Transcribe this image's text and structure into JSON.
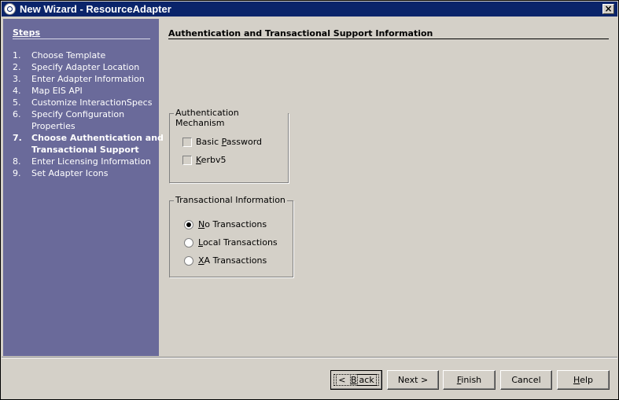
{
  "window": {
    "title": "New Wizard - ResourceAdapter",
    "close_label": "×"
  },
  "sidebar": {
    "heading": "Steps",
    "steps": [
      {
        "num": "1.",
        "label": "Choose Template"
      },
      {
        "num": "2.",
        "label": "Specify Adapter Location"
      },
      {
        "num": "3.",
        "label": "Enter Adapter Information"
      },
      {
        "num": "4.",
        "label": "Map EIS API"
      },
      {
        "num": "5.",
        "label": "Customize InteractionSpecs"
      },
      {
        "num": "6.",
        "label_line1": "Specify Configuration",
        "label_line2": "Properties"
      },
      {
        "num": "7.",
        "label_line1": "Choose Authentication and",
        "label_line2": "Transactional Support"
      },
      {
        "num": "8.",
        "label": "Enter Licensing Information"
      },
      {
        "num": "9.",
        "label": "Set Adapter Icons"
      }
    ],
    "active_step": 7
  },
  "main": {
    "title": "Authentication and Transactional Support Information",
    "auth": {
      "legend": "Authentication Mechanism",
      "options": [
        {
          "label_pre": "Basic ",
          "mnemonic": "P",
          "label_post": "assword",
          "checked": false
        },
        {
          "label_pre": "",
          "mnemonic": "K",
          "label_post": "erbv5",
          "checked": false
        }
      ]
    },
    "transactions": {
      "legend": "Transactional Information",
      "options": [
        {
          "label_pre": "",
          "mnemonic": "N",
          "label_post": "o Transactions",
          "selected": true
        },
        {
          "label_pre": "",
          "mnemonic": "L",
          "label_post": "ocal Transactions",
          "selected": false
        },
        {
          "label_pre": "",
          "mnemonic": "X",
          "label_post": "A Transactions",
          "selected": false
        }
      ]
    }
  },
  "buttons": {
    "back": {
      "pre": "< ",
      "mnemonic": "B",
      "post": "ack"
    },
    "next": {
      "label": "Next >"
    },
    "finish": {
      "pre": "",
      "mnemonic": "F",
      "post": "inish"
    },
    "cancel": {
      "label": "Cancel"
    },
    "help": {
      "pre": "",
      "mnemonic": "H",
      "post": "elp"
    }
  }
}
